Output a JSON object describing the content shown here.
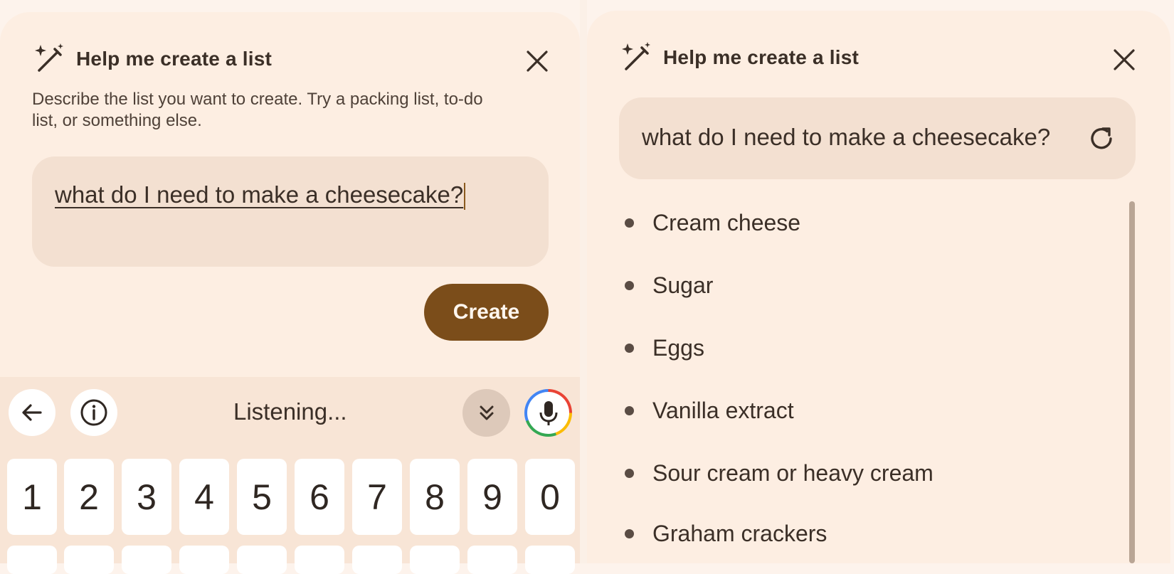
{
  "left_panel": {
    "title": "Help me create a list",
    "description": "Describe the list you want to create. Try a packing list, to-do list, or something else.",
    "prompt_value": "what do I need to make a cheesecake?",
    "create_label": "Create",
    "icons": {
      "magic": "magic-wand-icon",
      "close": "close-icon"
    }
  },
  "keyboard": {
    "status": "Listening...",
    "keys": [
      "1",
      "2",
      "3",
      "4",
      "5",
      "6",
      "7",
      "8",
      "9",
      "0"
    ],
    "icons": {
      "back": "back-arrow-icon",
      "info": "info-icon",
      "collapse": "double-chevron-down-icon",
      "mic": "microphone-icon"
    }
  },
  "right_panel": {
    "title": "Help me create a list",
    "prompt_value": "what do I need to make a cheesecake?",
    "items": [
      "Cream cheese",
      "Sugar",
      "Eggs",
      "Vanilla extract",
      "Sour cream or heavy cream",
      "Graham crackers"
    ],
    "icons": {
      "magic": "magic-wand-icon",
      "close": "close-icon",
      "refresh": "refresh-icon"
    }
  },
  "colors": {
    "background": "#fdf3ec",
    "sheet": "#fdeee2",
    "prompt_box": "#f3e0d1",
    "create_button": "#7b4d1a",
    "keyboard": "#f8e5d6"
  }
}
